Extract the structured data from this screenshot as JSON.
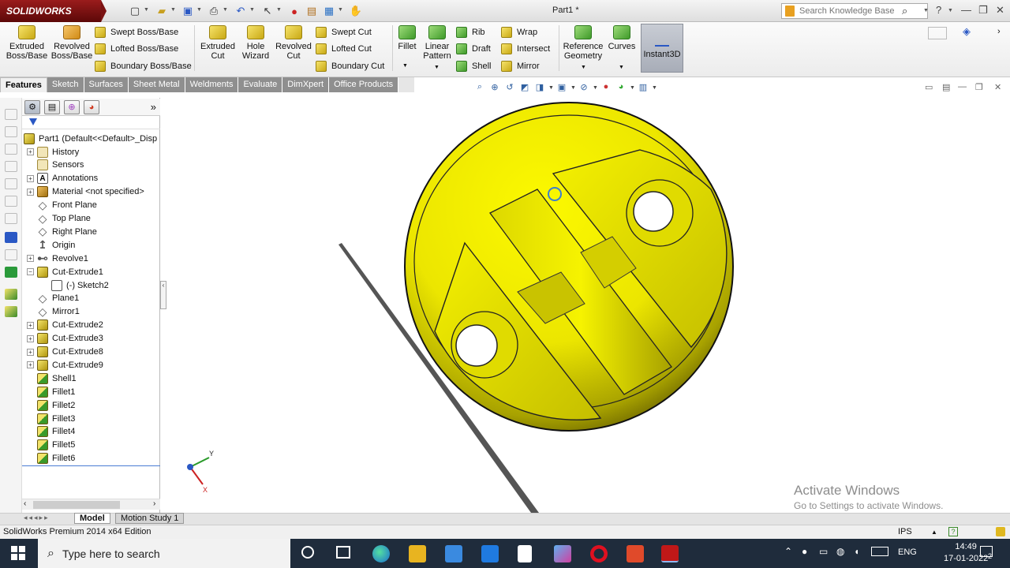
{
  "app": {
    "logo_text": "SOLIDWORKS",
    "document_title": "Part1 *"
  },
  "search": {
    "placeholder": "Search Knowledge Base"
  },
  "ribbon": {
    "extruded_boss": "Extruded Boss/Base",
    "revolved_boss": "Revolved Boss/Base",
    "swept_boss": "Swept Boss/Base",
    "lofted_boss": "Lofted Boss/Base",
    "boundary_boss": "Boundary Boss/Base",
    "extruded_cut": "Extruded Cut",
    "hole_wizard": "Hole Wizard",
    "revolved_cut": "Revolved Cut",
    "swept_cut": "Swept Cut",
    "lofted_cut": "Lofted Cut",
    "boundary_cut": "Boundary Cut",
    "fillet": "Fillet",
    "linear_pattern": "Linear Pattern",
    "rib": "Rib",
    "draft": "Draft",
    "shell": "Shell",
    "wrap": "Wrap",
    "intersect": "Intersect",
    "mirror": "Mirror",
    "reference_geometry": "Reference Geometry",
    "curves": "Curves",
    "instant3d": "Instant3D"
  },
  "tabs": [
    "Features",
    "Sketch",
    "Surfaces",
    "Sheet Metal",
    "Weldments",
    "Evaluate",
    "DimXpert",
    "Office Products"
  ],
  "tree": {
    "root": "Part1  (Default<<Default>_Disp",
    "items": [
      {
        "label": "History",
        "icon": "history-icon"
      },
      {
        "label": "Sensors",
        "icon": "sensors-icon"
      },
      {
        "label": "Annotations",
        "icon": "annotations-icon"
      },
      {
        "label": "Material <not specified>",
        "icon": "material-icon"
      },
      {
        "label": "Front Plane",
        "icon": "plane-icon"
      },
      {
        "label": "Top Plane",
        "icon": "plane-icon"
      },
      {
        "label": "Right Plane",
        "icon": "plane-icon"
      },
      {
        "label": "Origin",
        "icon": "origin-icon"
      },
      {
        "label": "Revolve1",
        "icon": "revolve-icon"
      },
      {
        "label": "Cut-Extrude1",
        "icon": "cut-extrude-icon"
      },
      {
        "label": "(-) Sketch2",
        "icon": "sketch-icon"
      },
      {
        "label": "Plane1",
        "icon": "plane-icon"
      },
      {
        "label": "Mirror1",
        "icon": "mirror-icon"
      },
      {
        "label": "Cut-Extrude2",
        "icon": "cut-extrude-icon"
      },
      {
        "label": "Cut-Extrude3",
        "icon": "cut-extrude-icon"
      },
      {
        "label": "Cut-Extrude8",
        "icon": "cut-extrude-icon"
      },
      {
        "label": "Cut-Extrude9",
        "icon": "cut-extrude-icon"
      },
      {
        "label": "Shell1",
        "icon": "shell-icon"
      },
      {
        "label": "Fillet1",
        "icon": "fillet-icon"
      },
      {
        "label": "Fillet2",
        "icon": "fillet-icon"
      },
      {
        "label": "Fillet3",
        "icon": "fillet-icon"
      },
      {
        "label": "Fillet4",
        "icon": "fillet-icon"
      },
      {
        "label": "Fillet5",
        "icon": "fillet-icon"
      },
      {
        "label": "Fillet6",
        "icon": "fillet-icon"
      }
    ]
  },
  "bottom_tabs": {
    "model": "Model",
    "motion": "Motion Study 1"
  },
  "status": {
    "edition": "SolidWorks Premium 2014 x64 Edition",
    "units": "IPS"
  },
  "watermark": {
    "line1": "Activate Windows",
    "line2": "Go to Settings to activate Windows."
  },
  "triad": {
    "x_label": "X",
    "y_label": "Y"
  },
  "taskbar": {
    "search_placeholder": "Type here to search",
    "lang": "ENG",
    "time": "14:49",
    "date": "17-01-2022",
    "notifications": "2"
  },
  "colors": {
    "model_yellow": "#f2ee00",
    "logo_red": "#8e1414",
    "taskbar": "#1f2c3c"
  }
}
